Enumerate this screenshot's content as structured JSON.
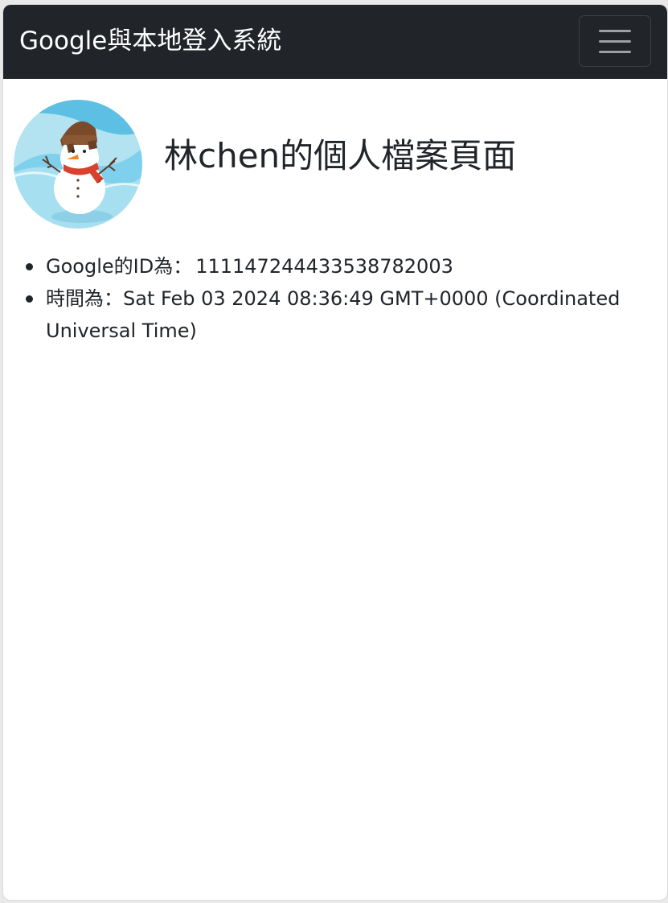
{
  "navbar": {
    "brand": "Google與本地登入系統",
    "toggle_icon": "hamburger-menu-icon"
  },
  "profile": {
    "avatar_icon": "snowman-avatar",
    "title": "林chen的個人檔案頁面"
  },
  "details": {
    "google_id_label": "Google的ID為：",
    "google_id_value": "111147244433538782003",
    "time_label": "時間為：",
    "time_value": "Sat Feb 03 2024 08:36:49 GMT+0000 (Coordinated Universal Time)"
  },
  "colors": {
    "navbar_bg": "#212529",
    "text": "#212529",
    "avatar_bg": "#5dbfe3"
  }
}
